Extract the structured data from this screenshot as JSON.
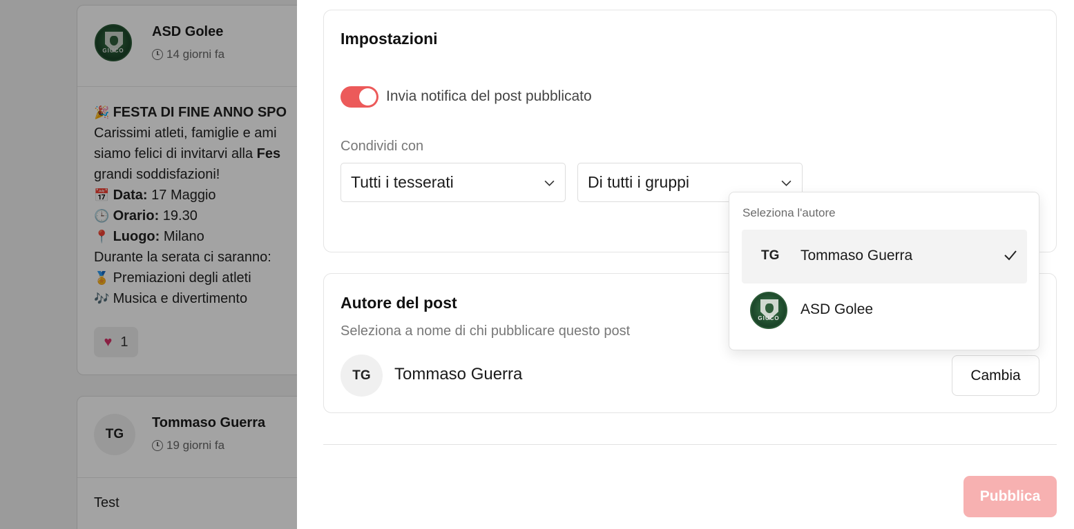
{
  "feed": {
    "post1": {
      "author": "ASD Golee",
      "time": "14 giorni fa",
      "logo_text": "GIUCO",
      "headline": "FESTA DI FINE ANNO SPO",
      "line1": "Carissimi atleti, famiglie e ami",
      "line2_a": "siamo felici di invitarvi alla ",
      "line2_b": "Fes",
      "line3": "grandi soddisfazioni!",
      "date_label": "Data:",
      "date_value": " 17 Maggio",
      "time_label": "Orario:",
      "time_value": " 19.30",
      "place_label": "Luogo:",
      "place_value": " Milano",
      "line7": "Durante la serata ci saranno:",
      "bullet1": "Premiazioni degli atleti",
      "bullet2": "Musica e divertimento",
      "reaction_count": "1"
    },
    "post2": {
      "initials": "TG",
      "author": "Tommaso Guerra",
      "time": "19 giorni fa",
      "body": "Test"
    }
  },
  "settings": {
    "title": "Impostazioni",
    "notify_label": "Invia notifica del post pubblicato",
    "notify_on": true,
    "share_label": "Condividi con",
    "select1": "Tutti i tesserati",
    "select2": "Di tutti i gruppi"
  },
  "author": {
    "title": "Autore del post",
    "subtitle": "Seleziona a nome di chi pubblicare questo post",
    "initials": "TG",
    "name": "Tommaso Guerra",
    "change_label": "Cambia"
  },
  "dropdown": {
    "title": "Seleziona l'autore",
    "items": [
      {
        "initials": "TG",
        "name": "Tommaso Guerra",
        "selected": true
      },
      {
        "name": "ASD Golee",
        "selected": false
      }
    ]
  },
  "footer": {
    "publish_label": "Pubblica"
  },
  "colors": {
    "accent": "#ec5a5a",
    "publish_disabled": "#f7b1b1"
  }
}
